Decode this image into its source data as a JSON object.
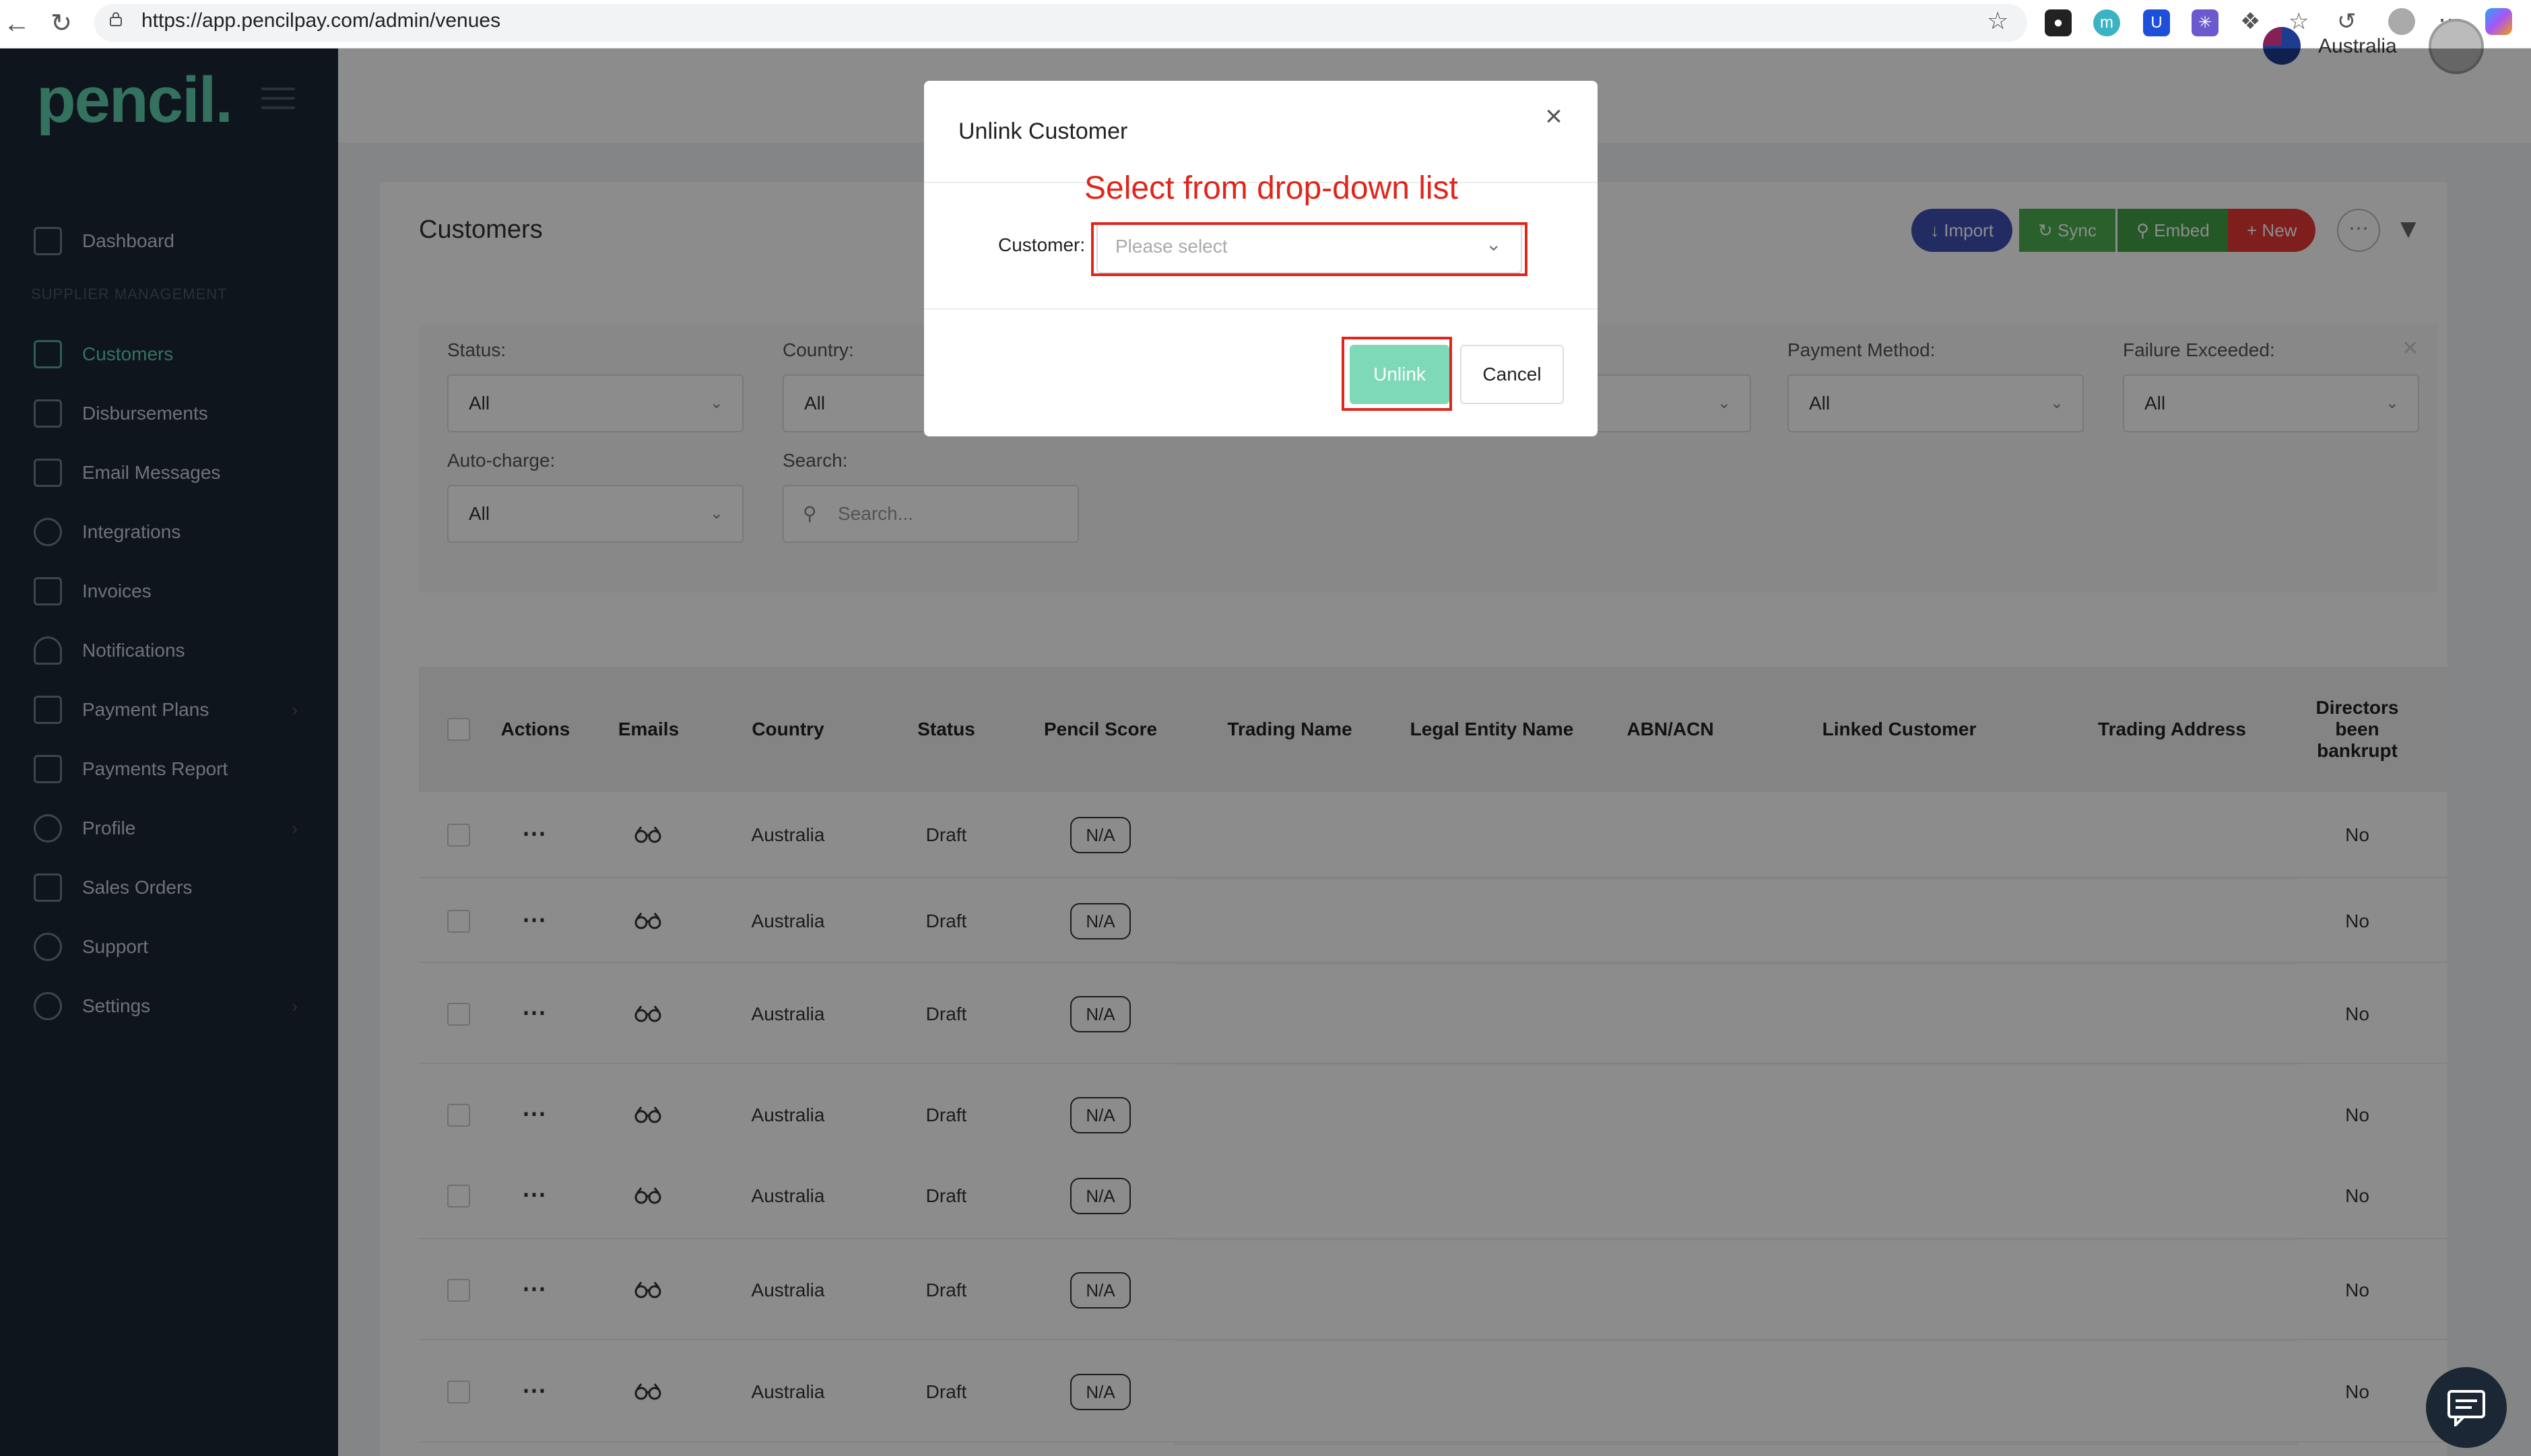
{
  "browser": {
    "url": "https://app.pencilpay.com/admin/venues"
  },
  "sidebar": {
    "logo": "pencil.",
    "section_title": "SUPPLIER MANAGEMENT",
    "items": [
      {
        "label": "Dashboard",
        "icon": "chart-icon"
      },
      {
        "label": "Customers",
        "icon": "list-icon",
        "active": true
      },
      {
        "label": "Disbursements",
        "icon": "database-icon"
      },
      {
        "label": "Email Messages",
        "icon": "mail-icon"
      },
      {
        "label": "Integrations",
        "icon": "infinity-icon"
      },
      {
        "label": "Invoices",
        "icon": "invoice-icon"
      },
      {
        "label": "Notifications",
        "icon": "bell-icon"
      },
      {
        "label": "Payment Plans",
        "icon": "payment-icon"
      },
      {
        "label": "Payments Report",
        "icon": "report-icon"
      },
      {
        "label": "Profile",
        "icon": "profile-icon"
      },
      {
        "label": "Sales Orders",
        "icon": "orders-icon"
      },
      {
        "label": "Support",
        "icon": "support-icon"
      },
      {
        "label": "Settings",
        "icon": "gear-icon"
      }
    ]
  },
  "header": {
    "country": "Australia"
  },
  "page": {
    "title": "Customers",
    "buttons": {
      "import": "Import",
      "sync": "Sync",
      "embed": "Embed",
      "new": "New"
    }
  },
  "filters": {
    "status_label": "Status:",
    "status_value": "All",
    "country_label": "Country:",
    "country_value": "All",
    "payment_method_label": "Payment Method:",
    "payment_method_value": "All",
    "failure_label": "Failure Exceeded:",
    "failure_value": "All",
    "autocharge_label": "Auto-charge:",
    "autocharge_value": "All",
    "search_label": "Search:",
    "search_placeholder": "Search..."
  },
  "table": {
    "columns": [
      "Actions",
      "Emails",
      "Country",
      "Status",
      "Pencil Score",
      "Trading Name",
      "Legal Entity Name",
      "ABN/ACN",
      "Linked Customer",
      "Trading Address",
      "Directors been bankrupt"
    ],
    "rows": [
      {
        "country": "Australia",
        "status": "Draft",
        "score": "N/A",
        "bankrupt": "No"
      },
      {
        "country": "Australia",
        "status": "Draft",
        "score": "N/A",
        "bankrupt": "No"
      },
      {
        "country": "Australia",
        "status": "Draft",
        "score": "N/A",
        "bankrupt": "No"
      },
      {
        "country": "Australia",
        "status": "Draft",
        "score": "N/A",
        "bankrupt": "No"
      },
      {
        "country": "Australia",
        "status": "Draft",
        "score": "N/A",
        "bankrupt": "No"
      },
      {
        "country": "Australia",
        "status": "Draft",
        "score": "N/A",
        "bankrupt": "No"
      },
      {
        "country": "Australia",
        "status": "Draft",
        "score": "N/A",
        "bankrupt": "No"
      }
    ]
  },
  "modal": {
    "title": "Unlink Customer",
    "customer_label": "Customer:",
    "customer_placeholder": "Please select",
    "annotation": "Select from drop-down list",
    "unlink": "Unlink",
    "cancel": "Cancel"
  },
  "colors": {
    "sidebar_bg": "#1b2734",
    "accent": "#5fd0ad",
    "import": "#3f51b5",
    "sync": "#4caf50",
    "embed": "#43a047",
    "new": "#e53935",
    "annotation_red": "#e0251b"
  }
}
